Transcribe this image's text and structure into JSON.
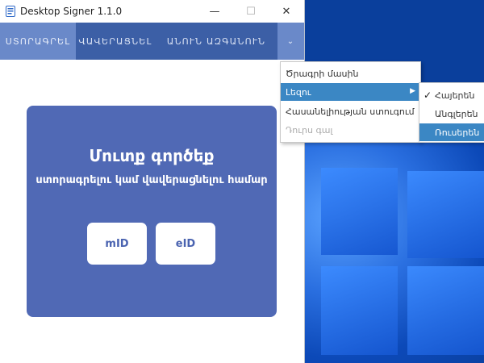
{
  "window": {
    "title": "Desktop Signer 1.1.0",
    "controls": {
      "minimize": "—",
      "maximize": "☐",
      "close": "✕"
    }
  },
  "nav": {
    "tabs": [
      "ՍՏՈՐԱԳՐԵԼ",
      "ՎԱՎԵՐԱՑՆԵԼ",
      "ԱՆՈՒՆ ԱԶԳԱՆՈՒՆ"
    ],
    "dropdown": "⌄",
    "active_tab": "ՍՏՈՐԱԳՐԵԼ"
  },
  "card": {
    "title": "Մուտք գործեք",
    "subtitle": "ստորագրելու կամ վավերացնելու համար",
    "buttons": [
      "mID",
      "eID"
    ]
  },
  "menu": {
    "items": [
      "Ծրագրի մասին",
      "Լեզու",
      "Հասանելիության ստուգում",
      "Դուրս գալ"
    ],
    "highlighted": "Լեզու",
    "disabled": "Դուրս գալ",
    "submenu_arrow": "▶"
  },
  "submenu": {
    "items": [
      "Հայերեն",
      "Անգլերեն",
      "Ռուսերեն"
    ],
    "checked": "Հայերեն",
    "check_mark": "✓",
    "highlighted": "Ռուսերեն"
  },
  "colors": {
    "navbar": "#3c5fa6",
    "active_tab": "#6a89c9",
    "card": "#5069b5",
    "menu_highlight": "#3b87c4",
    "desktop": "#0a3f9c"
  }
}
